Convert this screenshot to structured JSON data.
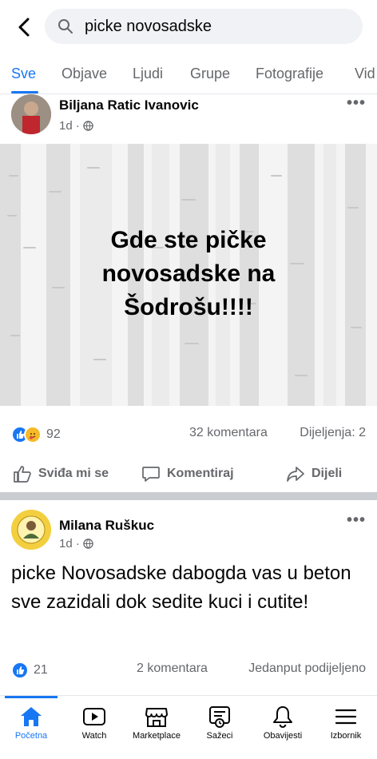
{
  "search": {
    "query": "picke novosadske"
  },
  "tabs": [
    {
      "label": "Sve"
    },
    {
      "label": "Objave"
    },
    {
      "label": "Ljudi"
    },
    {
      "label": "Grupe"
    },
    {
      "label": "Fotografije"
    },
    {
      "label": "Vid"
    }
  ],
  "post1": {
    "author": "Biljana Ratic Ivanovic",
    "time": "1d ·",
    "image_text_lines": [
      "Gde ste pičke",
      "novosadske na",
      "Šodrošu!!!!"
    ],
    "reaction_count": "92",
    "comments": "32 komentara",
    "shares": "Dijeljenja: 2"
  },
  "actions": {
    "like": "Sviđa mi se",
    "comment": "Komentiraj",
    "share": "Dijeli"
  },
  "post2": {
    "author": "Milana Ruškuc",
    "time": "1d ·",
    "text": "picke Novosadske dabogda vas u beton sve zazidali dok sedite kuci i cutite!",
    "reaction_count": "21",
    "comments": "2 komentara",
    "shares": "Jedanput podijeljeno"
  },
  "bottom_nav": [
    {
      "label": "Početna",
      "icon": "home-icon"
    },
    {
      "label": "Watch",
      "icon": "watch-icon"
    },
    {
      "label": "Marketplace",
      "icon": "marketplace-icon"
    },
    {
      "label": "Sažeci",
      "icon": "feeds-icon"
    },
    {
      "label": "Obavijesti",
      "icon": "bell-icon"
    },
    {
      "label": "Izbornik",
      "icon": "menu-icon"
    }
  ],
  "colors": {
    "accent": "#1877f2",
    "secondary_text": "#65676b",
    "like_blue": "#1877f2",
    "haha_yellow": "#f7b928"
  }
}
